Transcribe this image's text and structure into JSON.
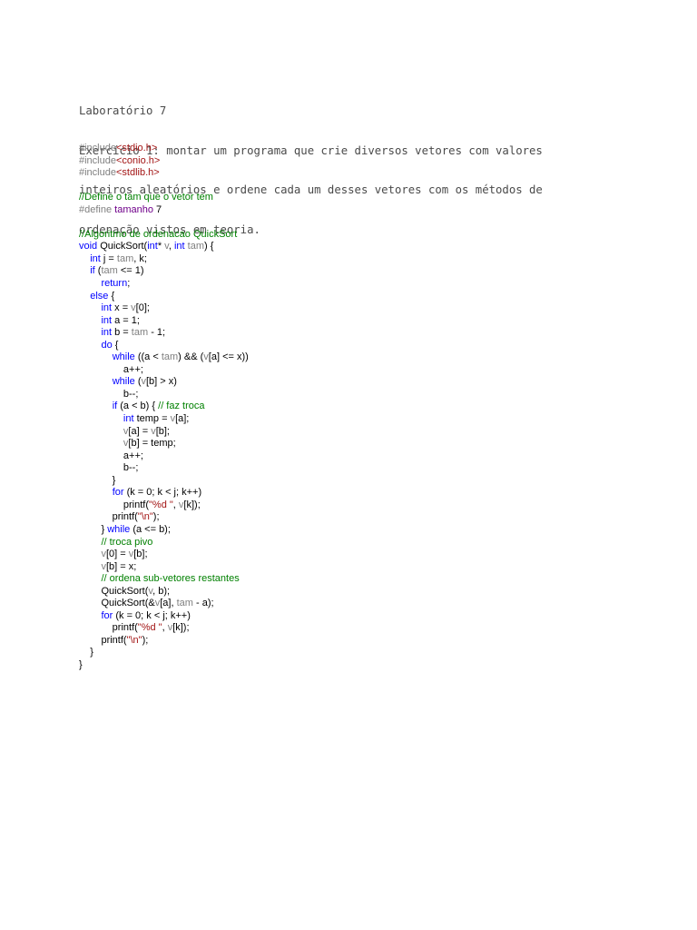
{
  "document": {
    "header_lines": [
      "Laboratório 7",
      "Exercício 1: montar um programa que crie diversos vetores com valores",
      "inteiros aleatórios e ordene cada um desses vetores com os métodos de",
      "ordenação vistos em teoria."
    ],
    "code_lines": [
      [
        [
          "p",
          "#include"
        ],
        [
          "s",
          "<stdio.h>"
        ]
      ],
      [
        [
          "p",
          "#include"
        ],
        [
          "s",
          "<conio.h>"
        ]
      ],
      [
        [
          "p",
          "#include"
        ],
        [
          "s",
          "<stdlib.h>"
        ]
      ],
      [],
      [
        [
          "c",
          "//Define o tam que o vetor tem"
        ]
      ],
      [
        [
          "p",
          "#define "
        ],
        [
          "t",
          "tamanho"
        ],
        [
          "n",
          " 7"
        ]
      ],
      [],
      [
        [
          "c",
          "//Algoritmo de ordenacao QuickSort"
        ]
      ],
      [
        [
          "k",
          "void"
        ],
        [
          "n",
          " QuickSort("
        ],
        [
          "k",
          "int"
        ],
        [
          "n",
          "* "
        ],
        [
          "v",
          "v"
        ],
        [
          "n",
          ", "
        ],
        [
          "k",
          "int"
        ],
        [
          "n",
          " "
        ],
        [
          "v",
          "tam"
        ],
        [
          "n",
          ") {"
        ]
      ],
      [
        [
          "n",
          "    "
        ],
        [
          "k",
          "int"
        ],
        [
          "n",
          " j = "
        ],
        [
          "v",
          "tam"
        ],
        [
          "n",
          ", k;"
        ]
      ],
      [
        [
          "n",
          "    "
        ],
        [
          "k",
          "if"
        ],
        [
          "n",
          " ("
        ],
        [
          "v",
          "tam"
        ],
        [
          "n",
          " <= 1)"
        ]
      ],
      [
        [
          "n",
          "        "
        ],
        [
          "k",
          "return"
        ],
        [
          "n",
          ";"
        ]
      ],
      [
        [
          "n",
          "    "
        ],
        [
          "k",
          "else"
        ],
        [
          "n",
          " {"
        ]
      ],
      [
        [
          "n",
          "        "
        ],
        [
          "k",
          "int"
        ],
        [
          "n",
          " x = "
        ],
        [
          "v",
          "v"
        ],
        [
          "n",
          "[0];"
        ]
      ],
      [
        [
          "n",
          "        "
        ],
        [
          "k",
          "int"
        ],
        [
          "n",
          " a = 1;"
        ]
      ],
      [
        [
          "n",
          "        "
        ],
        [
          "k",
          "int"
        ],
        [
          "n",
          " b = "
        ],
        [
          "v",
          "tam"
        ],
        [
          "n",
          " - 1;"
        ]
      ],
      [
        [
          "n",
          "        "
        ],
        [
          "k",
          "do"
        ],
        [
          "n",
          " {"
        ]
      ],
      [
        [
          "n",
          "            "
        ],
        [
          "k",
          "while"
        ],
        [
          "n",
          " ((a < "
        ],
        [
          "v",
          "tam"
        ],
        [
          "n",
          ") && ("
        ],
        [
          "v",
          "v"
        ],
        [
          "n",
          "[a] <= x))"
        ]
      ],
      [
        [
          "n",
          "                a++;"
        ]
      ],
      [
        [
          "n",
          "            "
        ],
        [
          "k",
          "while"
        ],
        [
          "n",
          " ("
        ],
        [
          "v",
          "v"
        ],
        [
          "n",
          "[b] > x)"
        ]
      ],
      [
        [
          "n",
          "                b--;"
        ]
      ],
      [
        [
          "n",
          "            "
        ],
        [
          "k",
          "if"
        ],
        [
          "n",
          " (a < b) { "
        ],
        [
          "c",
          "// faz troca"
        ]
      ],
      [
        [
          "n",
          "                "
        ],
        [
          "k",
          "int"
        ],
        [
          "n",
          " temp = "
        ],
        [
          "v",
          "v"
        ],
        [
          "n",
          "[a];"
        ]
      ],
      [
        [
          "n",
          "                "
        ],
        [
          "v",
          "v"
        ],
        [
          "n",
          "[a] = "
        ],
        [
          "v",
          "v"
        ],
        [
          "n",
          "[b];"
        ]
      ],
      [
        [
          "n",
          "                "
        ],
        [
          "v",
          "v"
        ],
        [
          "n",
          "[b] = temp;"
        ]
      ],
      [
        [
          "n",
          "                a++;"
        ]
      ],
      [
        [
          "n",
          "                b--;"
        ]
      ],
      [
        [
          "n",
          "            }"
        ]
      ],
      [
        [
          "n",
          "            "
        ],
        [
          "k",
          "for"
        ],
        [
          "n",
          " (k = 0; k < j; k++)"
        ]
      ],
      [
        [
          "n",
          "                printf("
        ],
        [
          "s",
          "\"%d \""
        ],
        [
          "n",
          ", "
        ],
        [
          "v",
          "v"
        ],
        [
          "n",
          "[k]);"
        ]
      ],
      [
        [
          "n",
          "            printf("
        ],
        [
          "s",
          "\"\\n\""
        ],
        [
          "n",
          ");"
        ]
      ],
      [
        [
          "n",
          "        } "
        ],
        [
          "k",
          "while"
        ],
        [
          "n",
          " (a <= b);"
        ]
      ],
      [
        [
          "n",
          "        "
        ],
        [
          "c",
          "// troca pivo"
        ]
      ],
      [
        [
          "n",
          "        "
        ],
        [
          "v",
          "v"
        ],
        [
          "n",
          "[0] = "
        ],
        [
          "v",
          "v"
        ],
        [
          "n",
          "[b];"
        ]
      ],
      [
        [
          "n",
          "        "
        ],
        [
          "v",
          "v"
        ],
        [
          "n",
          "[b] = x;"
        ]
      ],
      [
        [
          "n",
          "        "
        ],
        [
          "c",
          "// ordena sub-vetores restantes"
        ]
      ],
      [
        [
          "n",
          "        QuickSort("
        ],
        [
          "v",
          "v"
        ],
        [
          "n",
          ", b);"
        ]
      ],
      [
        [
          "n",
          "        QuickSort(&"
        ],
        [
          "v",
          "v"
        ],
        [
          "n",
          "[a], "
        ],
        [
          "v",
          "tam"
        ],
        [
          "n",
          " - a);"
        ]
      ],
      [
        [
          "n",
          "        "
        ],
        [
          "k",
          "for"
        ],
        [
          "n",
          " (k = 0; k < j; k++)"
        ]
      ],
      [
        [
          "n",
          "            printf("
        ],
        [
          "s",
          "\"%d \""
        ],
        [
          "n",
          ", "
        ],
        [
          "v",
          "v"
        ],
        [
          "n",
          "[k]);"
        ]
      ],
      [
        [
          "n",
          "        printf("
        ],
        [
          "s",
          "\"\\n\""
        ],
        [
          "n",
          ");"
        ]
      ],
      [
        [
          "n",
          "    }"
        ]
      ],
      [
        [
          "n",
          "}"
        ]
      ]
    ]
  },
  "colors": {
    "keyword": "#0000ff",
    "comment": "#008000",
    "preprocessor": "#808080",
    "string": "#a31515",
    "parameter": "#7f7f7f",
    "macro": "#6f008a"
  }
}
